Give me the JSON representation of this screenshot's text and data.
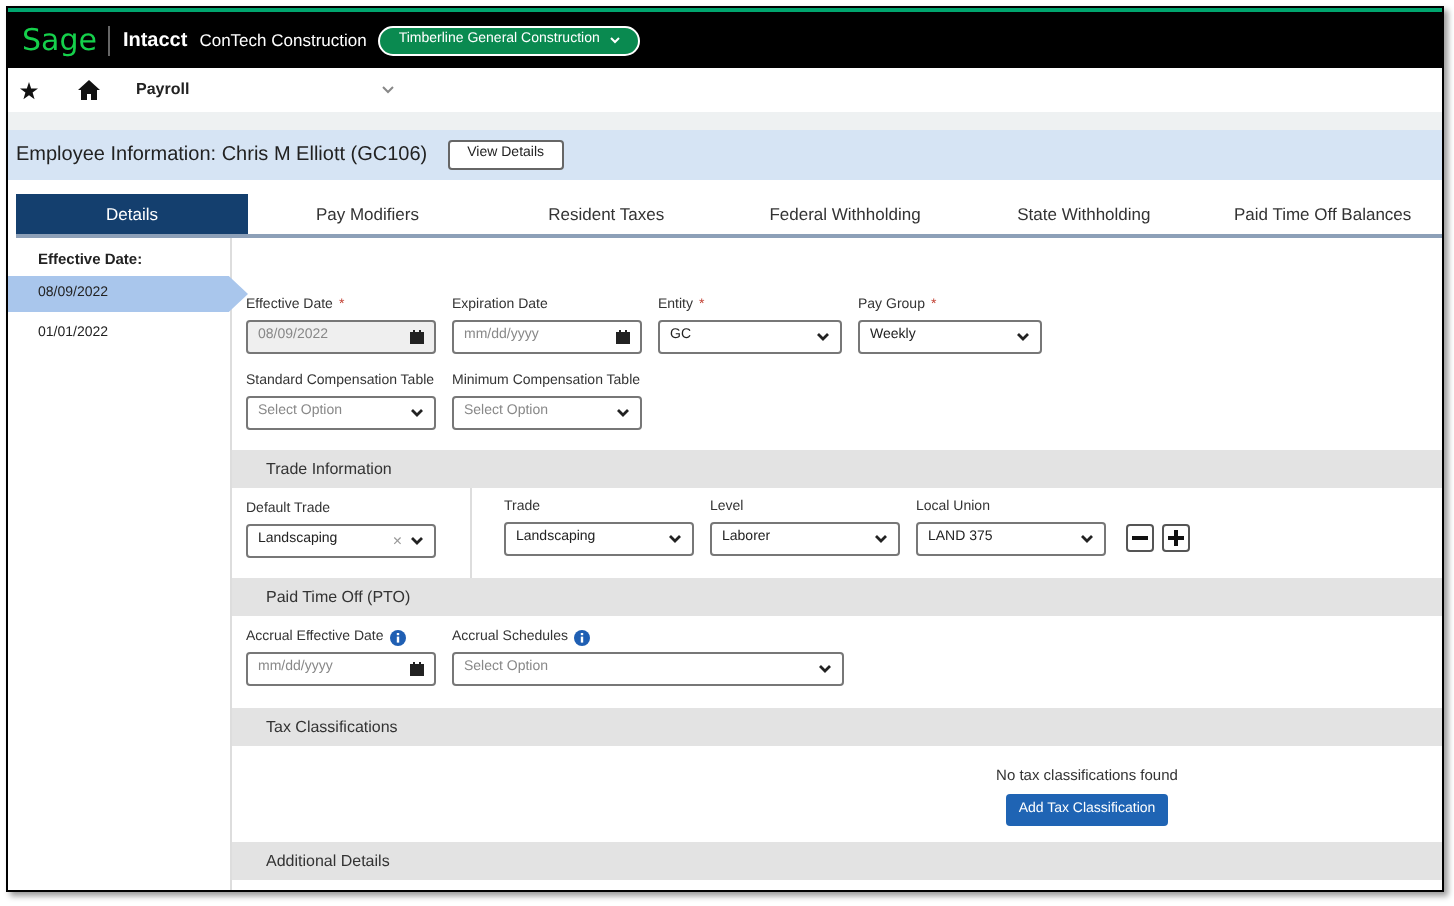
{
  "header": {
    "logo": "Sage",
    "product": "Intacct",
    "company": "ConTech Construction",
    "entity_pill": "Timberline General Construction"
  },
  "nav": {
    "module": "Payroll"
  },
  "employee": {
    "title": "Employee Information: Chris M Elliott (GC106)",
    "button": "View Details"
  },
  "tabs": [
    {
      "label": "Details",
      "selected": true
    },
    {
      "label": "Pay Modifiers",
      "selected": false
    },
    {
      "label": "Resident Taxes",
      "selected": false
    },
    {
      "label": "Federal Withholding",
      "selected": false
    },
    {
      "label": "State Withholding",
      "selected": false
    },
    {
      "label": "Paid Time Off Balances",
      "selected": false
    }
  ],
  "sidebar": {
    "heading": "Effective Date:",
    "items": [
      {
        "label": "08/09/2022",
        "selected": true
      },
      {
        "label": "01/01/2022",
        "selected": false
      }
    ]
  },
  "general_fields": [
    [
      {
        "kind": "date",
        "label": "Effective Date",
        "mark": "*",
        "value": "08/09/2022",
        "disabled": true
      },
      {
        "kind": "date",
        "label": "Expiration Date",
        "placeholder": "mm/dd/yyyy"
      },
      {
        "kind": "select",
        "label": "Entity",
        "mark": "*",
        "value": "GC"
      },
      {
        "kind": "select",
        "label": "Pay Group",
        "mark": "*",
        "value": "Weekly"
      }
    ],
    [
      {
        "kind": "select",
        "label": "Standard Compensation Table",
        "placeholder": "Select Option"
      },
      {
        "kind": "select",
        "label": "Minimum Compensation Table",
        "placeholder": "Select Option"
      }
    ]
  ],
  "trade_section": {
    "title": "Trade Information",
    "default_trade": {
      "kind": "select",
      "label": "Default Trade",
      "value": "Landscaping",
      "clear": "×"
    },
    "fields": [
      {
        "kind": "select",
        "label": "Trade",
        "value": "Landscaping"
      },
      {
        "kind": "select",
        "label": "Level",
        "value": "Laborer"
      },
      {
        "kind": "select",
        "label": "Local Union",
        "value": "LAND 375"
      }
    ]
  },
  "pto_section": {
    "title": "Paid Time Off (PTO)",
    "fields": [
      {
        "kind": "date",
        "label": "Accrual Effective Date",
        "info": true,
        "placeholder": "mm/dd/yyyy"
      },
      {
        "kind": "select",
        "label": "Accrual Schedules",
        "info": true,
        "placeholder": "Select Option"
      }
    ]
  },
  "tax_section": {
    "title": "Tax Classifications",
    "empty_text": "No tax classifications found",
    "button": "Add Tax Classification"
  },
  "additional_section": {
    "title": "Additional Details"
  }
}
